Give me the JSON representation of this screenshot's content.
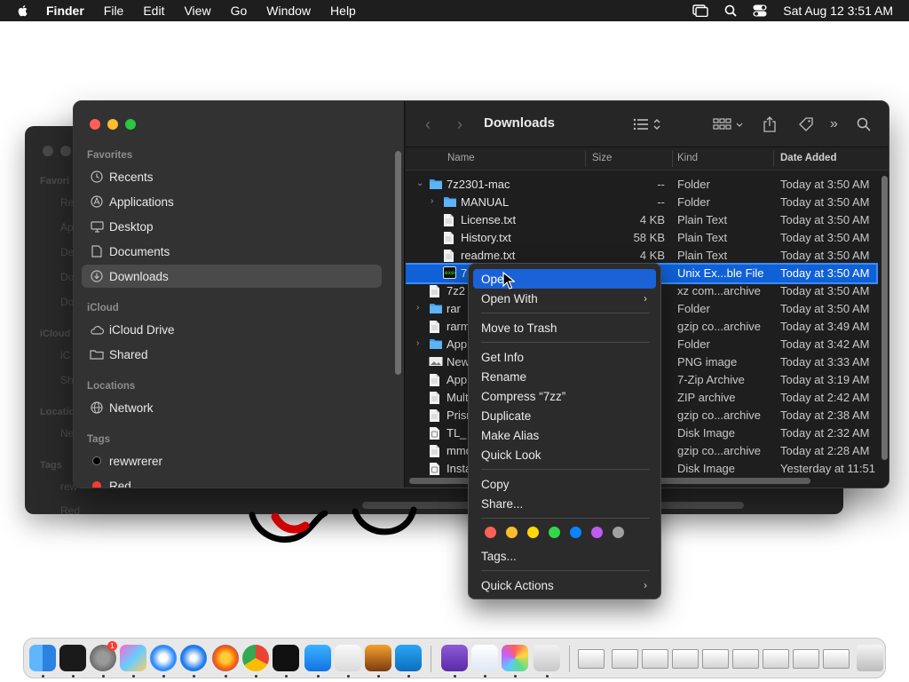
{
  "menubar": {
    "app": "Finder",
    "menus": [
      "File",
      "Edit",
      "View",
      "Go",
      "Window",
      "Help"
    ],
    "datetime": "Sat Aug 12  3:51 AM"
  },
  "background_window": {
    "ghost_labels": [
      "Favori",
      "Re",
      "Ap",
      "De",
      "Do",
      "Do",
      "iCloud",
      "iC",
      "Sh",
      "Locatio",
      "Ne",
      "Tags",
      "rew",
      "Red"
    ]
  },
  "window": {
    "title": "Downloads",
    "sidebar": {
      "favorites_header": "Favorites",
      "favorites": [
        {
          "label": "Recents",
          "icon": "clock-icon"
        },
        {
          "label": "Applications",
          "icon": "applications-icon"
        },
        {
          "label": "Desktop",
          "icon": "desktop-icon"
        },
        {
          "label": "Documents",
          "icon": "document-icon"
        },
        {
          "label": "Downloads",
          "icon": "download-icon",
          "selected": true
        }
      ],
      "icloud_header": "iCloud",
      "icloud": [
        {
          "label": "iCloud Drive",
          "icon": "cloud-icon"
        },
        {
          "label": "Shared",
          "icon": "shared-folder-icon"
        }
      ],
      "locations_header": "Locations",
      "locations": [
        {
          "label": "Network",
          "icon": "globe-icon"
        }
      ],
      "tags_header": "Tags",
      "tags": [
        {
          "label": "rewwrerer",
          "color": "#000000"
        },
        {
          "label": "Red",
          "color": "#ff3b30"
        }
      ]
    },
    "columns": {
      "name": "Name",
      "size": "Size",
      "kind": "Kind",
      "date": "Date Added"
    },
    "rows": [
      {
        "disc": "v",
        "indent": 0,
        "icon": "folder",
        "name": "7z2301-mac",
        "size": "--",
        "kind": "Folder",
        "date": "Today at 3:50 AM"
      },
      {
        "disc": ">",
        "indent": 1,
        "icon": "folder",
        "name": "MANUAL",
        "size": "--",
        "kind": "Folder",
        "date": "Today at 3:50 AM"
      },
      {
        "disc": "",
        "indent": 1,
        "icon": "doc",
        "name": "License.txt",
        "size": "4 KB",
        "kind": "Plain Text",
        "date": "Today at 3:50 AM"
      },
      {
        "disc": "",
        "indent": 1,
        "icon": "doc",
        "name": "History.txt",
        "size": "58 KB",
        "kind": "Plain Text",
        "date": "Today at 3:50 AM"
      },
      {
        "disc": "",
        "indent": 1,
        "icon": "doc",
        "name": "readme.txt",
        "size": "4 KB",
        "kind": "Plain Text",
        "date": "Today at 3:50 AM"
      },
      {
        "disc": "",
        "indent": 1,
        "icon": "exec",
        "name": "7zz",
        "size": "",
        "kind": "Unix Ex...ble File",
        "date": "Today at 3:50 AM",
        "selected": true
      },
      {
        "disc": "",
        "indent": 0,
        "icon": "doc",
        "name": "7z2",
        "size": "",
        "kind": "xz com...archive",
        "date": "Today at 3:50 AM"
      },
      {
        "disc": ">",
        "indent": 0,
        "icon": "folder",
        "name": "rar",
        "size": "",
        "kind": "Folder",
        "date": "Today at 3:50 AM"
      },
      {
        "disc": "",
        "indent": 0,
        "icon": "doc",
        "name": "rarm",
        "size": "",
        "kind": "gzip co...archive",
        "date": "Today at 3:49 AM"
      },
      {
        "disc": ">",
        "indent": 0,
        "icon": "folder",
        "name": "App",
        "size": "",
        "kind": "Folder",
        "date": "Today at 3:42 AM"
      },
      {
        "disc": "",
        "indent": 0,
        "icon": "img",
        "name": "New",
        "size": "",
        "kind": "PNG image",
        "date": "Today at 3:33 AM"
      },
      {
        "disc": "",
        "indent": 0,
        "icon": "doc",
        "name": "App",
        "size": "",
        "kind": "7-Zip Archive",
        "date": "Today at 3:19 AM"
      },
      {
        "disc": "",
        "indent": 0,
        "icon": "doc",
        "name": "Mult",
        "size": "",
        "kind": "ZIP archive",
        "date": "Today at 2:42 AM"
      },
      {
        "disc": "",
        "indent": 0,
        "icon": "doc",
        "name": "Prisr",
        "size": "",
        "kind": "gzip co...archive",
        "date": "Today at 2:38 AM"
      },
      {
        "disc": "",
        "indent": 0,
        "icon": "disk",
        "name": "TL_",
        "size": "",
        "kind": "Disk Image",
        "date": "Today at 2:32 AM"
      },
      {
        "disc": "",
        "indent": 0,
        "icon": "doc",
        "name": "mmc",
        "size": "",
        "kind": "gzip co...archive",
        "date": "Today at 2:28 AM"
      },
      {
        "disc": "",
        "indent": 0,
        "icon": "disk",
        "name": "Insta",
        "size": "",
        "kind": "Disk Image",
        "date": "Yesterday at 11:51"
      }
    ]
  },
  "context_menu": {
    "open": "Open",
    "open_with": "Open With",
    "move_to_trash": "Move to Trash",
    "get_info": "Get Info",
    "rename": "Rename",
    "compress": "Compress “7zz”",
    "duplicate": "Duplicate",
    "make_alias": "Make Alias",
    "quick_look": "Quick Look",
    "copy": "Copy",
    "share": "Share...",
    "tag_colors": [
      "#ff5f57",
      "#febc2e",
      "#ffd60a",
      "#32d74b",
      "#0a84ff",
      "#bf5af2",
      "#a0a0a0"
    ],
    "tags": "Tags...",
    "quick_actions": "Quick Actions"
  },
  "dock": {
    "apps": [
      "finder",
      "terminal",
      "system-settings",
      "launchpad",
      "safari",
      "safari-alt",
      "firefox",
      "chrome",
      "stocks-widget",
      "app-store",
      "textedit",
      "garageband",
      "vscode",
      "visual-studio",
      "freeform",
      "pixelmator",
      "preview"
    ],
    "settings_badge": "1"
  }
}
